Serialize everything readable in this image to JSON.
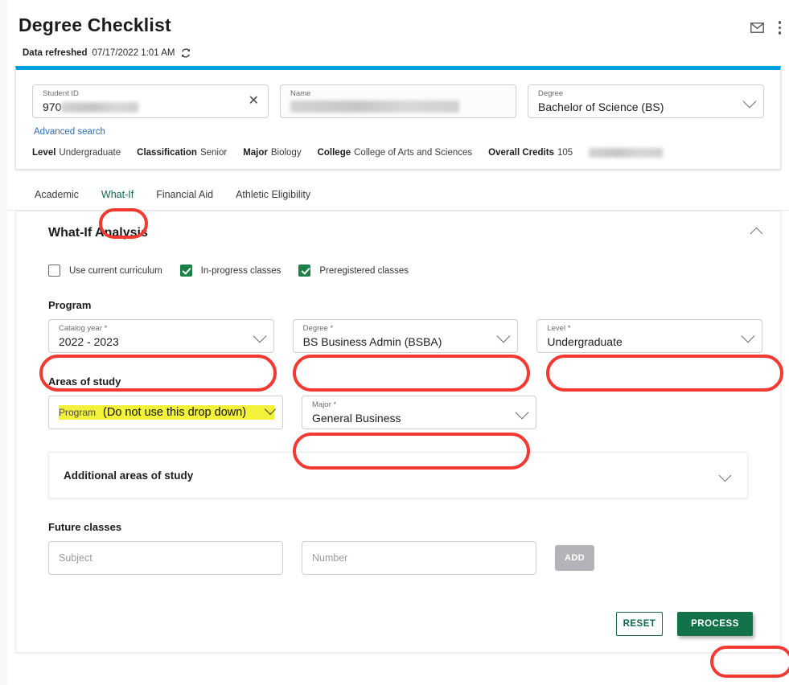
{
  "header": {
    "title": "Degree Checklist",
    "refreshed_label": "Data refreshed",
    "refreshed_value": "07/17/2022 1:01 AM",
    "mail_icon": "mail-icon",
    "more_icon": "more-vertical-icon",
    "refresh_icon": "refresh-icon"
  },
  "student_search": {
    "student_id": {
      "label": "Student ID",
      "value": "970",
      "redacted": true
    },
    "name": {
      "label": "Name",
      "value": "",
      "redacted": true
    },
    "degree": {
      "label": "Degree",
      "value": "Bachelor of Science (BS)"
    },
    "advanced_search": "Advanced search",
    "clear_icon": "clear-icon"
  },
  "student_meta": [
    {
      "label": "Level",
      "value": "Undergraduate"
    },
    {
      "label": "Classification",
      "value": "Senior"
    },
    {
      "label": "Major",
      "value": "Biology"
    },
    {
      "label": "College",
      "value": "College of Arts and Sciences"
    },
    {
      "label": "Overall Credits",
      "value": "105"
    }
  ],
  "tabs": [
    {
      "label": "Academic",
      "active": false
    },
    {
      "label": "What-If",
      "active": true,
      "annotated": true
    },
    {
      "label": "Financial Aid",
      "active": false
    },
    {
      "label": "Athletic Eligibility",
      "active": false
    }
  ],
  "whatif": {
    "title": "What-If Analysis",
    "collapse_icon": "chevron-up-icon",
    "checkboxes": [
      {
        "label": "Use current curriculum",
        "checked": false
      },
      {
        "label": "In-progress classes",
        "checked": true
      },
      {
        "label": "Preregistered classes",
        "checked": true
      }
    ],
    "program_heading": "Program",
    "program_fields": [
      {
        "label": "Catalog year *",
        "value": "2022 - 2023",
        "annotated": true
      },
      {
        "label": "Degree *",
        "value": "BS Business Admin (BSBA)",
        "annotated": true
      },
      {
        "label": "Level *",
        "value": "Undergraduate",
        "annotated": true
      }
    ],
    "areas_heading": "Areas of study",
    "areas_program": {
      "label": "Program",
      "warning": "(Do not use this drop down)",
      "highlight_color": "#f2f23a"
    },
    "areas_major": {
      "label": "Major *",
      "value": "General Business",
      "annotated": true
    },
    "additional_areas": {
      "label": "Additional areas of study",
      "chevron_icon": "chevron-down-icon"
    },
    "future_heading": "Future classes",
    "future_subject_placeholder": "Subject",
    "future_number_placeholder": "Number",
    "future_subject_value": "",
    "future_number_value": "",
    "add_button": "ADD",
    "reset_button": "RESET",
    "process_button": "PROCESS"
  },
  "colors": {
    "accent_blue": "#00a0e0",
    "brand_green": "#12724a",
    "annotation_red": "#f23a32",
    "highlight_yellow": "#f2f23a",
    "link_blue": "#2c6dbd"
  }
}
